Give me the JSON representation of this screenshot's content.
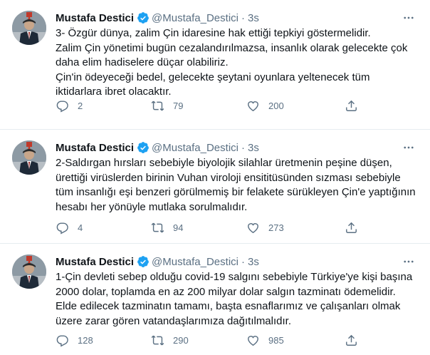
{
  "colors": {
    "verified": "#1da1f2",
    "secondary_text": "#5b7083",
    "primary_text": "#0f1419",
    "divider": "#e6ecf0"
  },
  "tweets": [
    {
      "name": "Mustafa Destici",
      "handle": "@Mustafa_Destici",
      "separator": "·",
      "time": "3s",
      "lines": [
        "3- Özgür dünya, zalim Çin idaresine hak ettiği tepkiyi göstermelidir.",
        "Zalim  Çin yönetimi bugün cezalandırılmazsa, insanlık olarak gelecekte çok",
        "daha elim hadiselere düçar olabiliriz.",
        "Çin'in ödeyeceği bedel, gelecekte şeytani oyunlara yeltenecek tüm",
        "iktidarlara ibret olacaktır."
      ],
      "replies": "2",
      "retweets": "79",
      "likes": "200"
    },
    {
      "name": "Mustafa Destici",
      "handle": "@Mustafa_Destici",
      "separator": "·",
      "time": "3s",
      "lines": [
        "2-Saldırgan hırsları sebebiyle biyolojik silahlar üretmenin peşine düşen,",
        "ürettiği virüslerden birinin Vuhan viroloji ensititüsünden sızması sebebiyle",
        "tüm insanlığı eşi benzeri görülmemiş bir felakete sürükleyen Çin'e yaptığının",
        "hesabı her yönüyle mutlaka sorulmalıdır."
      ],
      "replies": "4",
      "retweets": "94",
      "likes": "273"
    },
    {
      "name": "Mustafa Destici",
      "handle": "@Mustafa_Destici",
      "separator": "·",
      "time": "3s",
      "lines": [
        "1-Çin devleti sebep olduğu covid-19 salgını sebebiyle Türkiye'ye kişi başına",
        "2000 dolar, toplamda en az 200 milyar dolar salgın tazminatı ödemelidir.",
        "Elde edilecek tazminatın tamamı, başta esnaflarımız ve çalışanları olmak",
        "üzere zarar gören vatandaşlarımıza dağıtılmalıdır."
      ],
      "replies": "128",
      "retweets": "290",
      "likes": "985"
    }
  ]
}
